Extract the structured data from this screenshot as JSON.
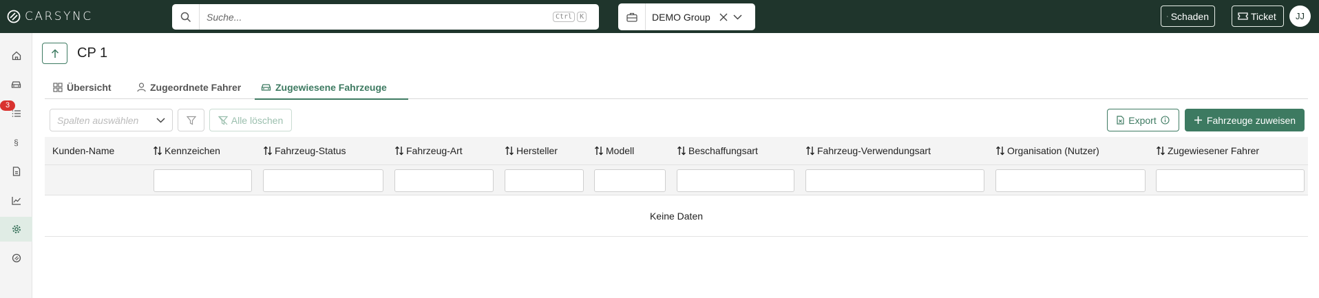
{
  "brand": {
    "name": "CARSYNC"
  },
  "search": {
    "placeholder": "Suche...",
    "shortcut_1": "Ctrl",
    "shortcut_2": "K"
  },
  "group_selector": {
    "value": "DEMO Group"
  },
  "header_actions": {
    "damage_label": "Schaden",
    "ticket_label": "Ticket",
    "avatar_initials": "JJ"
  },
  "sidebar": {
    "items": [
      {
        "icon": "home-icon"
      },
      {
        "icon": "car-icon"
      },
      {
        "icon": "list-icon",
        "badge": "3"
      },
      {
        "icon": "paragraph-icon"
      },
      {
        "icon": "document-icon"
      },
      {
        "icon": "chart-icon"
      },
      {
        "icon": "gear-icon",
        "active": true
      },
      {
        "icon": "tag-icon"
      }
    ]
  },
  "page": {
    "title": "CP 1"
  },
  "tabs": [
    {
      "label": "Übersicht",
      "icon": "grid-icon"
    },
    {
      "label": "Zugeordnete Fahrer",
      "icon": "user-icon"
    },
    {
      "label": "Zugewiesene Fahrzeuge",
      "icon": "car-icon",
      "active": true
    }
  ],
  "toolbar": {
    "columns_placeholder": "Spalten auswählen",
    "clear_label": "Alle löschen",
    "export_label": "Export",
    "assign_label": "Fahrzeuge zuweisen"
  },
  "table": {
    "columns": [
      "Kunden-Name",
      "Kennzeichen",
      "Fahrzeug-Status",
      "Fahrzeug-Art",
      "Hersteller",
      "Modell",
      "Beschaffungsart",
      "Fahrzeug-Verwendungsart",
      "Organisation (Nutzer)",
      "Zugewiesener Fahrer"
    ],
    "empty_text": "Keine Daten"
  },
  "colors": {
    "topbar": "#1f352c",
    "accent": "#3d7a61",
    "badge": "#d9322f"
  }
}
